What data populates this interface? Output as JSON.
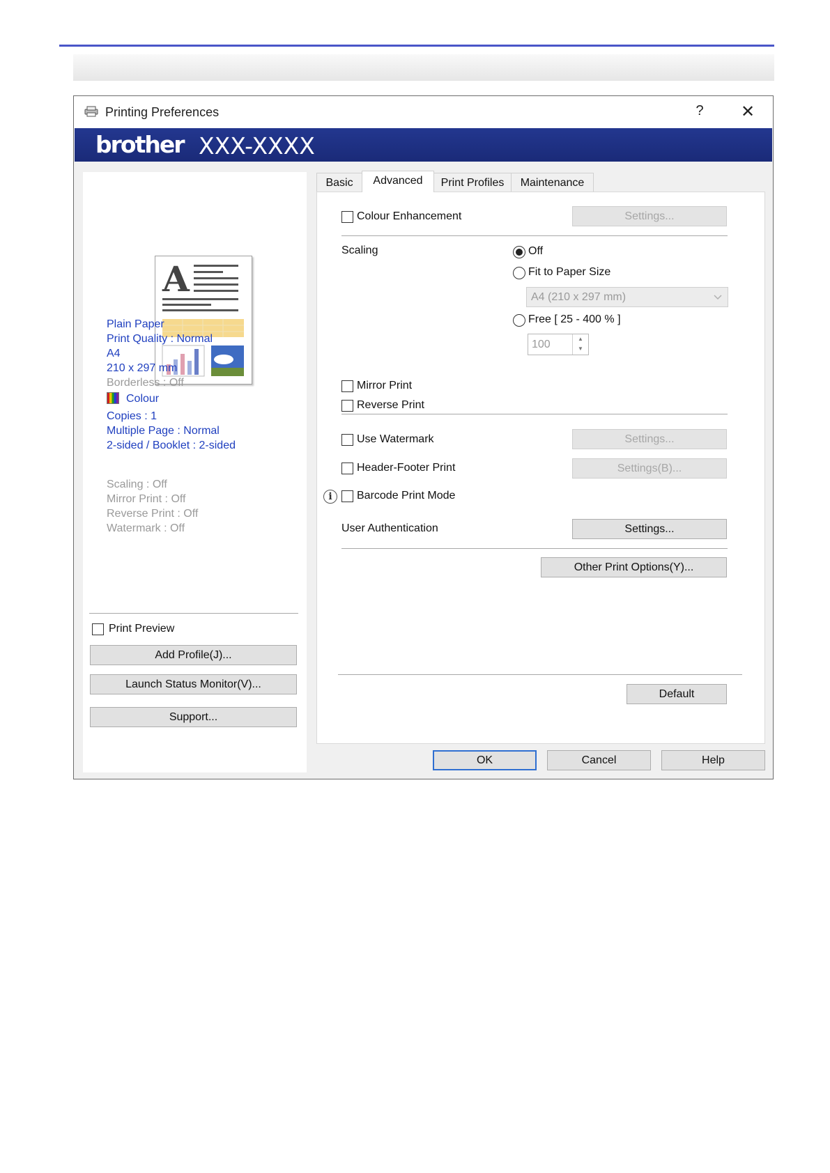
{
  "dialog": {
    "title": "Printing Preferences",
    "help_glyph": "?",
    "close_glyph": "✕",
    "brand": "brother",
    "model": "XXX-XXXX"
  },
  "summary": {
    "media": "Plain Paper",
    "quality": "Print Quality : Normal",
    "paper": "A4",
    "dimensions": "210 x 297 mm",
    "borderless": "Borderless : Off",
    "colour": "Colour",
    "copies": "Copies : 1",
    "multiple_page": "Multiple Page : Normal",
    "duplex": "2-sided / Booklet : 2-sided",
    "scaling": "Scaling : Off",
    "mirror": "Mirror Print : Off",
    "reverse": "Reverse Print : Off",
    "watermark": "Watermark : Off"
  },
  "left_actions": {
    "print_preview": "Print Preview",
    "add_profile": "Add Profile(J)...",
    "status_monitor": "Launch Status Monitor(V)...",
    "support": "Support..."
  },
  "tabs": [
    "Basic",
    "Advanced",
    "Print Profiles",
    "Maintenance"
  ],
  "active_tab": "Advanced",
  "advanced": {
    "colour_enhancement": "Colour Enhancement",
    "colour_settings": "Settings...",
    "scaling_label": "Scaling",
    "scaling_off": "Off",
    "fit_to_paper": "Fit to Paper Size",
    "paper_size_value": "A4 (210 x 297 mm)",
    "free": "Free [ 25 - 400 % ]",
    "free_value": "100",
    "mirror_print": "Mirror Print",
    "reverse_print": "Reverse Print",
    "use_watermark": "Use Watermark",
    "watermark_settings": "Settings...",
    "header_footer": "Header-Footer Print",
    "header_footer_settings": "Settings(B)...",
    "barcode_mode": "Barcode Print Mode",
    "user_auth": "User Authentication",
    "user_auth_settings": "Settings...",
    "other_options": "Other Print Options(Y)...",
    "default": "Default"
  },
  "footer": {
    "ok": "OK",
    "cancel": "Cancel",
    "help": "Help"
  },
  "colors": {
    "brand_bar": "#1f3184",
    "summary_text": "#1f3fbf",
    "rule": "#4a56c8"
  }
}
